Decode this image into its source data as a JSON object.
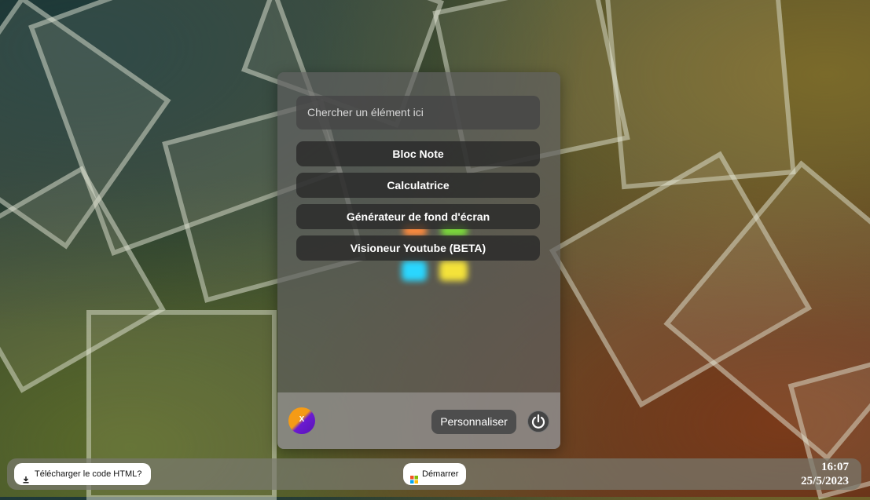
{
  "start_menu": {
    "search": {
      "placeholder": "Chercher un élément ici"
    },
    "apps": [
      {
        "label": "Bloc Note"
      },
      {
        "label": "Calculatrice"
      },
      {
        "label": "Générateur de fond d'écran"
      },
      {
        "label": "Visioneur Youtube (BETA)"
      }
    ],
    "footer": {
      "avatar_icon": "user-avatar-icon",
      "customize_label": "Personnaliser",
      "power_icon": "power-icon"
    }
  },
  "taskbar": {
    "download_label": "Télécharger le code HTML?",
    "download_icon": "download-icon",
    "start_label": "Démarrer",
    "start_icon": "windows-logo-icon",
    "clock": {
      "time": "16:07",
      "date": "25/5/2023"
    }
  }
}
